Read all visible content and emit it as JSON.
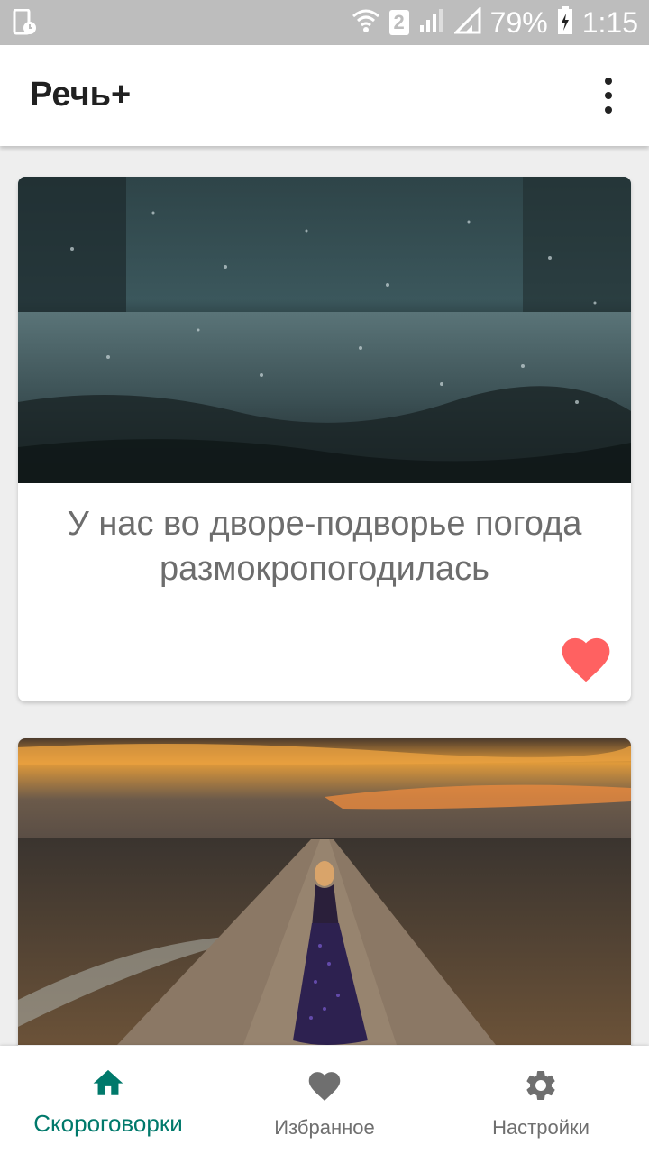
{
  "status_bar": {
    "sim": "2",
    "battery": "79%",
    "time": "1:15"
  },
  "app_bar": {
    "title": "Речь+",
    "menu_icon": "more-vert-icon"
  },
  "cards": [
    {
      "text": "У нас во дворе-подворье погода размокропогодилась",
      "image": "rain-puddle-photo",
      "favorite": true
    },
    {
      "text": "",
      "image": "woman-on-road-sunset-photo",
      "favorite": false
    }
  ],
  "bottom_nav": {
    "items": [
      {
        "label": "Скороговорки",
        "icon": "home-icon",
        "active": true
      },
      {
        "label": "Избранное",
        "icon": "heart-icon",
        "active": false
      },
      {
        "label": "Настройки",
        "icon": "gear-icon",
        "active": false
      }
    ]
  },
  "colors": {
    "accent": "#00796b",
    "heart": "#ff6161",
    "inactive_nav": "#6f6f6f",
    "status_bar": "#bdbdbd"
  }
}
